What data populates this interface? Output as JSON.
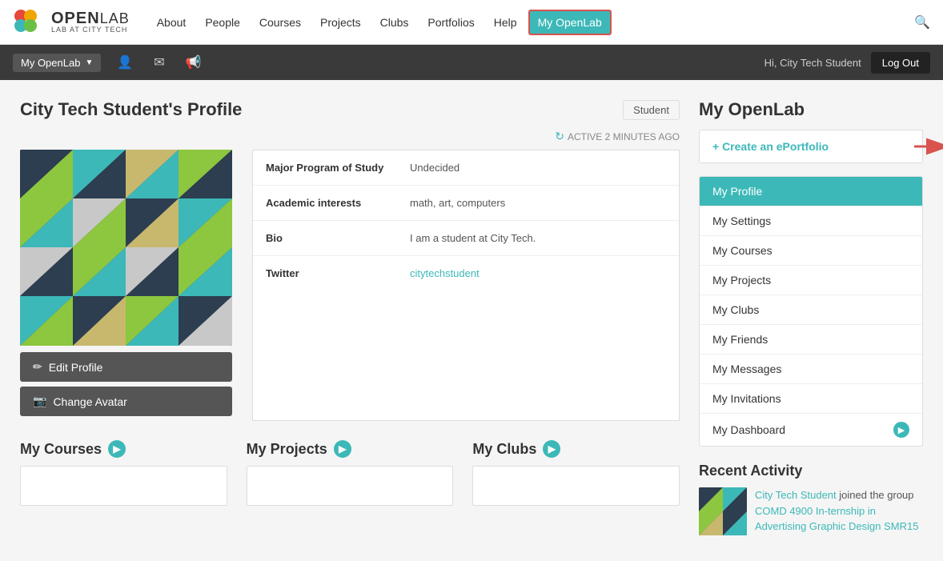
{
  "nav": {
    "logo_open": "OPEN",
    "logo_lab": "LAB AT CITY TECH",
    "links": [
      {
        "label": "About",
        "active": false
      },
      {
        "label": "People",
        "active": false
      },
      {
        "label": "Courses",
        "active": false
      },
      {
        "label": "Projects",
        "active": false
      },
      {
        "label": "Clubs",
        "active": false
      },
      {
        "label": "Portfolios",
        "active": false
      },
      {
        "label": "Help",
        "active": false
      },
      {
        "label": "My OpenLab",
        "active": true
      }
    ]
  },
  "secondary_nav": {
    "dropdown_label": "My OpenLab",
    "greeting": "Hi, City Tech Student",
    "logout_label": "Log Out"
  },
  "profile": {
    "page_title": "City Tech Student's Profile",
    "badge": "Student",
    "active_status": "ACTIVE 2 MINUTES AGO",
    "fields": [
      {
        "label": "Major Program of Study",
        "value": "Undecided",
        "is_link": false
      },
      {
        "label": "Academic interests",
        "value": "math, art, computers",
        "is_link": false
      },
      {
        "label": "Bio",
        "value": "I am a student at City Tech.",
        "is_link": false
      },
      {
        "label": "Twitter",
        "value": "citytechstudent",
        "is_link": true
      }
    ],
    "edit_profile_btn": "Edit Profile",
    "change_avatar_btn": "Change Avatar"
  },
  "bottom_sections": [
    {
      "title": "My Courses",
      "show_arrow": true
    },
    {
      "title": "My Projects",
      "show_arrow": true
    },
    {
      "title": "My Clubs",
      "show_arrow": true
    }
  ],
  "sidebar": {
    "title": "My OpenLab",
    "create_eportfolio": "+ Create an ePortfolio",
    "menu_items": [
      {
        "label": "My Profile",
        "active": true,
        "has_arrow": false
      },
      {
        "label": "My Settings",
        "active": false,
        "has_arrow": false
      },
      {
        "label": "My Courses",
        "active": false,
        "has_arrow": false
      },
      {
        "label": "My Projects",
        "active": false,
        "has_arrow": false
      },
      {
        "label": "My Clubs",
        "active": false,
        "has_arrow": false
      },
      {
        "label": "My Friends",
        "active": false,
        "has_arrow": false
      },
      {
        "label": "My Messages",
        "active": false,
        "has_arrow": false
      },
      {
        "label": "My Invitations",
        "active": false,
        "has_arrow": false
      },
      {
        "label": "My Dashboard",
        "active": false,
        "has_arrow": true
      }
    ],
    "recent_activity_title": "Recent Activity",
    "activity_text_1": "City Tech Student",
    "activity_text_2": " joined the group ",
    "activity_link": "COMD 4900 In-ternship in Advertising Graphic Design SMR15"
  }
}
